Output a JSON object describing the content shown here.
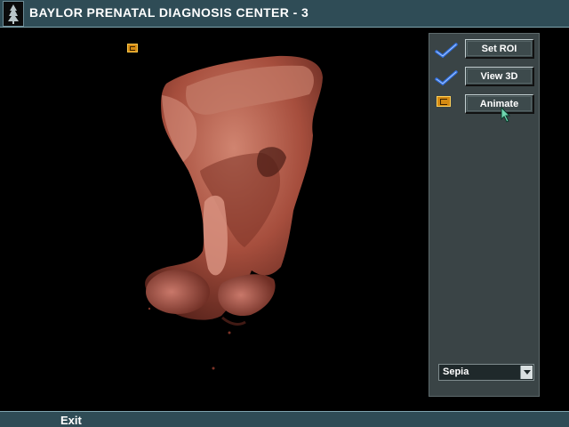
{
  "titlebar": {
    "title": "BAYLOR PRENATAL DIAGNOSIS CENTER - 3",
    "icon": "tree-icon"
  },
  "viewport": {
    "content": "3d-ultrasound-rendering",
    "colors": {
      "render_dark": "#5a241c",
      "render_mid": "#8e3f31",
      "render_light": "#d08470"
    }
  },
  "panel": {
    "buttons": {
      "set_roi": "Set ROI",
      "view_3d": "View 3D",
      "animate": "Animate"
    },
    "indicators": [
      "check-icon",
      "check-icon",
      "folder-icon"
    ],
    "color_scheme": {
      "selected": "Sepia"
    }
  },
  "bottombar": {
    "exit_label": "Exit"
  },
  "colors": {
    "titlebar": "#2f4c56",
    "panel": "#3a4446",
    "marker": "#d48a12"
  }
}
